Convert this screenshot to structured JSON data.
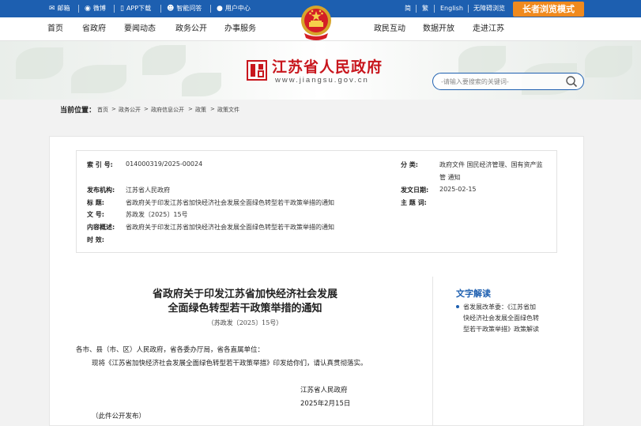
{
  "topbar": {
    "mail": "邮箱",
    "weibo": "微博",
    "app": "APP下载",
    "assistant": "智能问答",
    "user_center": "用户中心",
    "simplified": "简",
    "traditional": "繁",
    "english": "English",
    "accessible": "无障碍浏览",
    "elder_mode": "长者浏览模式"
  },
  "nav": {
    "items_left": [
      "首页",
      "省政府",
      "要闻动态",
      "政务公开",
      "办事服务"
    ],
    "items_right": [
      "政民互动",
      "数据开放",
      "走进江苏"
    ]
  },
  "banner": {
    "site_name": "江苏省人民政府",
    "site_url": "www.jiangsu.gov.cn",
    "search_placeholder": "-请输入要搜索的关键词-"
  },
  "breadcrumb": {
    "label": "当前位置：",
    "items": [
      "首页",
      ">",
      "政务公开",
      ">",
      "政府信息公开",
      ">",
      "政策",
      ">",
      "政策文件"
    ]
  },
  "meta": {
    "index_label": "索 引 号:",
    "index_value": "014000319/2025-00024",
    "category_label": "分 类:",
    "category_value_line1": "政府文件 国民经济管理、国有资产监",
    "category_value_line2": "管 通知",
    "issuer_label": "发布机构:",
    "issuer_value": "江苏省人民政府",
    "date_label": "发文日期:",
    "date_value": "2025-02-15",
    "title_label": "标 题:",
    "title_value": "省政府关于印发江苏省加快经济社会发展全面绿色转型若干政策举措的通知",
    "subject_label": "主 题 词:",
    "subject_value": "",
    "docnum_label": "文 号:",
    "docnum_value": "苏政发〔2025〕15号",
    "summary_label": "内容概述:",
    "summary_value": "省政府关于印发江苏省加快经济社会发展全面绿色转型若干政策举措的通知",
    "validity_label": "时 效:",
    "validity_value": ""
  },
  "document": {
    "title_line1": "省政府关于印发江苏省加快经济社会发展",
    "title_line2": "全面绿色转型若干政策举措的通知",
    "number": "（苏政发〔2025〕15号）",
    "addressee": "各市、县（市、区）人民政府，省各委办厅局，省各直属单位：",
    "body": "现将《江苏省加快经济社会发展全面绿色转型若干政策举措》印发给你们，请认真贯彻落实。",
    "signature": "江苏省人民政府",
    "sign_date": "2025年2月15日",
    "note": "（此件公开发布）"
  },
  "sidebar": {
    "title": "文字解读",
    "link_line1": "省发展改革委：《江苏省加",
    "link_line2": "快经济社会发展全面绿色转",
    "link_line3": "型若干政策举措》政策解读"
  },
  "colors": {
    "primary_blue": "#1d5fb0",
    "elder_orange": "#f08a1e",
    "logo_red": "#c8161d"
  }
}
